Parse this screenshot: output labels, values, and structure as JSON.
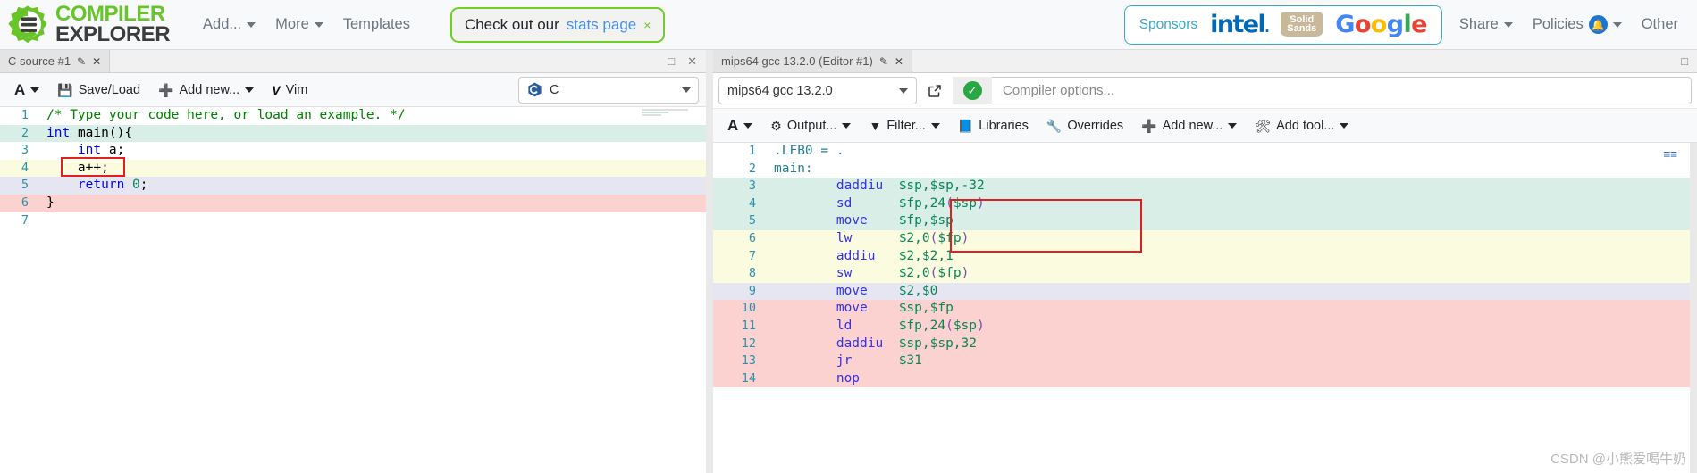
{
  "navbar": {
    "brand": {
      "line1": "COMPILER",
      "line2": "EXPLORER",
      "logo_icon": "compiler-explorer-gear-logo"
    },
    "items": [
      {
        "label": "Add...",
        "has_caret": true
      },
      {
        "label": "More",
        "has_caret": true
      },
      {
        "label": "Templates",
        "has_caret": false
      }
    ],
    "stats_pill": {
      "text": "Check out our",
      "link": "stats page",
      "close": "×"
    },
    "sponsors": {
      "label": "Sponsors",
      "logos": [
        "intel",
        "solid-sands",
        "google"
      ],
      "solid_sands_line1": "Solid",
      "solid_sands_line2": "Sands",
      "google_letters": [
        "G",
        "o",
        "o",
        "g",
        "l",
        "e"
      ]
    },
    "right_items": [
      {
        "label": "Share",
        "has_caret": true,
        "badge": null
      },
      {
        "label": "Policies",
        "has_caret": true,
        "badge": "🔔"
      },
      {
        "label": "Other",
        "has_caret": true,
        "badge": null
      }
    ]
  },
  "editor_pane": {
    "tab_label": "C source #1",
    "tab_edit_icon": "pencil-icon",
    "tab_close_icon": "close-icon",
    "maximize_icon": "maximize-icon",
    "close_icon": "close-icon",
    "toolbar": {
      "font_label": "A",
      "save_load": "Save/Load",
      "add_new": "Add new...",
      "vim": "Vim"
    },
    "language": {
      "value": "C",
      "icon": "c-language-icon"
    },
    "code_lines": [
      {
        "n": "1",
        "hl": "hl-none",
        "tokens": [
          {
            "t": "/* Type your code here, or load an example. */",
            "c": "c-comment"
          }
        ]
      },
      {
        "n": "2",
        "hl": "hl-teal",
        "tokens": [
          {
            "t": "int",
            "c": "c-kw"
          },
          {
            "t": " ",
            "c": "c-punct"
          },
          {
            "t": "main",
            "c": "c-ident"
          },
          {
            "t": "(){",
            "c": "c-punct"
          }
        ]
      },
      {
        "n": "3",
        "hl": "hl-none",
        "tokens": [
          {
            "t": "    ",
            "c": "c-punct"
          },
          {
            "t": "int",
            "c": "c-kw"
          },
          {
            "t": " a;",
            "c": "c-ident"
          }
        ]
      },
      {
        "n": "4",
        "hl": "hl-yellow",
        "tokens": [
          {
            "t": "    a++;",
            "c": "c-ident"
          }
        ]
      },
      {
        "n": "5",
        "hl": "hl-lav",
        "tokens": [
          {
            "t": "    ",
            "c": "c-punct"
          },
          {
            "t": "return",
            "c": "c-kw"
          },
          {
            "t": " ",
            "c": "c-punct"
          },
          {
            "t": "0",
            "c": "c-num"
          },
          {
            "t": ";",
            "c": "c-punct"
          }
        ]
      },
      {
        "n": "6",
        "hl": "hl-pink",
        "tokens": [
          {
            "t": "}",
            "c": "c-punct"
          }
        ]
      },
      {
        "n": "7",
        "hl": "hl-none",
        "tokens": [
          {
            "t": "",
            "c": "c-punct"
          }
        ]
      }
    ]
  },
  "compiler_pane": {
    "tab_label": "mips64 gcc 13.2.0 (Editor #1)",
    "tab_edit_icon": "pencil-icon",
    "tab_close_icon": "close-icon",
    "maximize_icon": "maximize-icon",
    "compiler_value": "mips64 gcc 13.2.0",
    "popout_icon": "open-in-new-icon",
    "status_icon": "compile-ok-icon",
    "options_placeholder": "Compiler options...",
    "toolbar": {
      "font_label": "A",
      "output": "Output...",
      "filter": "Filter...",
      "libraries": "Libraries",
      "overrides": "Overrides",
      "add_new": "Add new...",
      "add_tool": "Add tool..."
    },
    "asm_lines": [
      {
        "n": "1",
        "hl": "hl-none",
        "tokens": [
          {
            "t": ".LFB0 = .",
            "c": "c-dir"
          }
        ]
      },
      {
        "n": "2",
        "hl": "hl-none",
        "tokens": [
          {
            "t": "main:",
            "c": "c-dir"
          }
        ]
      },
      {
        "n": "3",
        "hl": "hl-teal",
        "tokens": [
          {
            "t": "        ",
            "c": "c-punct"
          },
          {
            "t": "daddiu",
            "c": "c-opcode"
          },
          {
            "t": "  ",
            "c": "c-punct"
          },
          {
            "t": "$sp,$sp,",
            "c": "c-reg"
          },
          {
            "t": "-32",
            "c": "c-num"
          }
        ]
      },
      {
        "n": "4",
        "hl": "hl-teal",
        "tokens": [
          {
            "t": "        ",
            "c": "c-punct"
          },
          {
            "t": "sd",
            "c": "c-opcode"
          },
          {
            "t": "      ",
            "c": "c-punct"
          },
          {
            "t": "$fp,",
            "c": "c-reg"
          },
          {
            "t": "24",
            "c": "c-num"
          },
          {
            "t": "(",
            "c": "c-paren"
          },
          {
            "t": "$sp",
            "c": "c-reg"
          },
          {
            "t": ")",
            "c": "c-paren"
          }
        ]
      },
      {
        "n": "5",
        "hl": "hl-teal",
        "tokens": [
          {
            "t": "        ",
            "c": "c-punct"
          },
          {
            "t": "move",
            "c": "c-opcode"
          },
          {
            "t": "    ",
            "c": "c-punct"
          },
          {
            "t": "$fp,$sp",
            "c": "c-reg"
          }
        ]
      },
      {
        "n": "6",
        "hl": "hl-yellow",
        "tokens": [
          {
            "t": "        ",
            "c": "c-punct"
          },
          {
            "t": "lw",
            "c": "c-opcode"
          },
          {
            "t": "      ",
            "c": "c-punct"
          },
          {
            "t": "$2,",
            "c": "c-reg"
          },
          {
            "t": "0",
            "c": "c-num"
          },
          {
            "t": "(",
            "c": "c-paren"
          },
          {
            "t": "$fp",
            "c": "c-reg"
          },
          {
            "t": ")",
            "c": "c-paren"
          }
        ]
      },
      {
        "n": "7",
        "hl": "hl-yellow",
        "tokens": [
          {
            "t": "        ",
            "c": "c-punct"
          },
          {
            "t": "addiu",
            "c": "c-opcode"
          },
          {
            "t": "   ",
            "c": "c-punct"
          },
          {
            "t": "$2,$2,",
            "c": "c-reg"
          },
          {
            "t": "1",
            "c": "c-num"
          }
        ]
      },
      {
        "n": "8",
        "hl": "hl-yellow",
        "tokens": [
          {
            "t": "        ",
            "c": "c-punct"
          },
          {
            "t": "sw",
            "c": "c-opcode"
          },
          {
            "t": "      ",
            "c": "c-punct"
          },
          {
            "t": "$2,",
            "c": "c-reg"
          },
          {
            "t": "0",
            "c": "c-num"
          },
          {
            "t": "(",
            "c": "c-paren"
          },
          {
            "t": "$fp",
            "c": "c-reg"
          },
          {
            "t": ")",
            "c": "c-paren"
          }
        ]
      },
      {
        "n": "9",
        "hl": "hl-lav",
        "tokens": [
          {
            "t": "        ",
            "c": "c-punct"
          },
          {
            "t": "move",
            "c": "c-opcode"
          },
          {
            "t": "    ",
            "c": "c-punct"
          },
          {
            "t": "$2,$0",
            "c": "c-reg"
          }
        ]
      },
      {
        "n": "10",
        "hl": "hl-pink",
        "tokens": [
          {
            "t": "        ",
            "c": "c-punct"
          },
          {
            "t": "move",
            "c": "c-opcode"
          },
          {
            "t": "    ",
            "c": "c-punct"
          },
          {
            "t": "$sp,$fp",
            "c": "c-reg"
          }
        ]
      },
      {
        "n": "11",
        "hl": "hl-pink",
        "tokens": [
          {
            "t": "        ",
            "c": "c-punct"
          },
          {
            "t": "ld",
            "c": "c-opcode"
          },
          {
            "t": "      ",
            "c": "c-punct"
          },
          {
            "t": "$fp,",
            "c": "c-reg"
          },
          {
            "t": "24",
            "c": "c-num"
          },
          {
            "t": "(",
            "c": "c-paren"
          },
          {
            "t": "$sp",
            "c": "c-reg"
          },
          {
            "t": ")",
            "c": "c-paren"
          }
        ]
      },
      {
        "n": "12",
        "hl": "hl-pink",
        "tokens": [
          {
            "t": "        ",
            "c": "c-punct"
          },
          {
            "t": "daddiu",
            "c": "c-opcode"
          },
          {
            "t": "  ",
            "c": "c-punct"
          },
          {
            "t": "$sp,$sp,",
            "c": "c-reg"
          },
          {
            "t": "32",
            "c": "c-num"
          }
        ]
      },
      {
        "n": "13",
        "hl": "hl-pink",
        "tokens": [
          {
            "t": "        ",
            "c": "c-punct"
          },
          {
            "t": "jr",
            "c": "c-opcode"
          },
          {
            "t": "      ",
            "c": "c-punct"
          },
          {
            "t": "$31",
            "c": "c-reg"
          }
        ]
      },
      {
        "n": "14",
        "hl": "hl-pink",
        "tokens": [
          {
            "t": "        ",
            "c": "c-punct"
          },
          {
            "t": "nop",
            "c": "c-opcode"
          }
        ]
      }
    ]
  },
  "watermark": "CSDN @小熊爱喝牛奶"
}
